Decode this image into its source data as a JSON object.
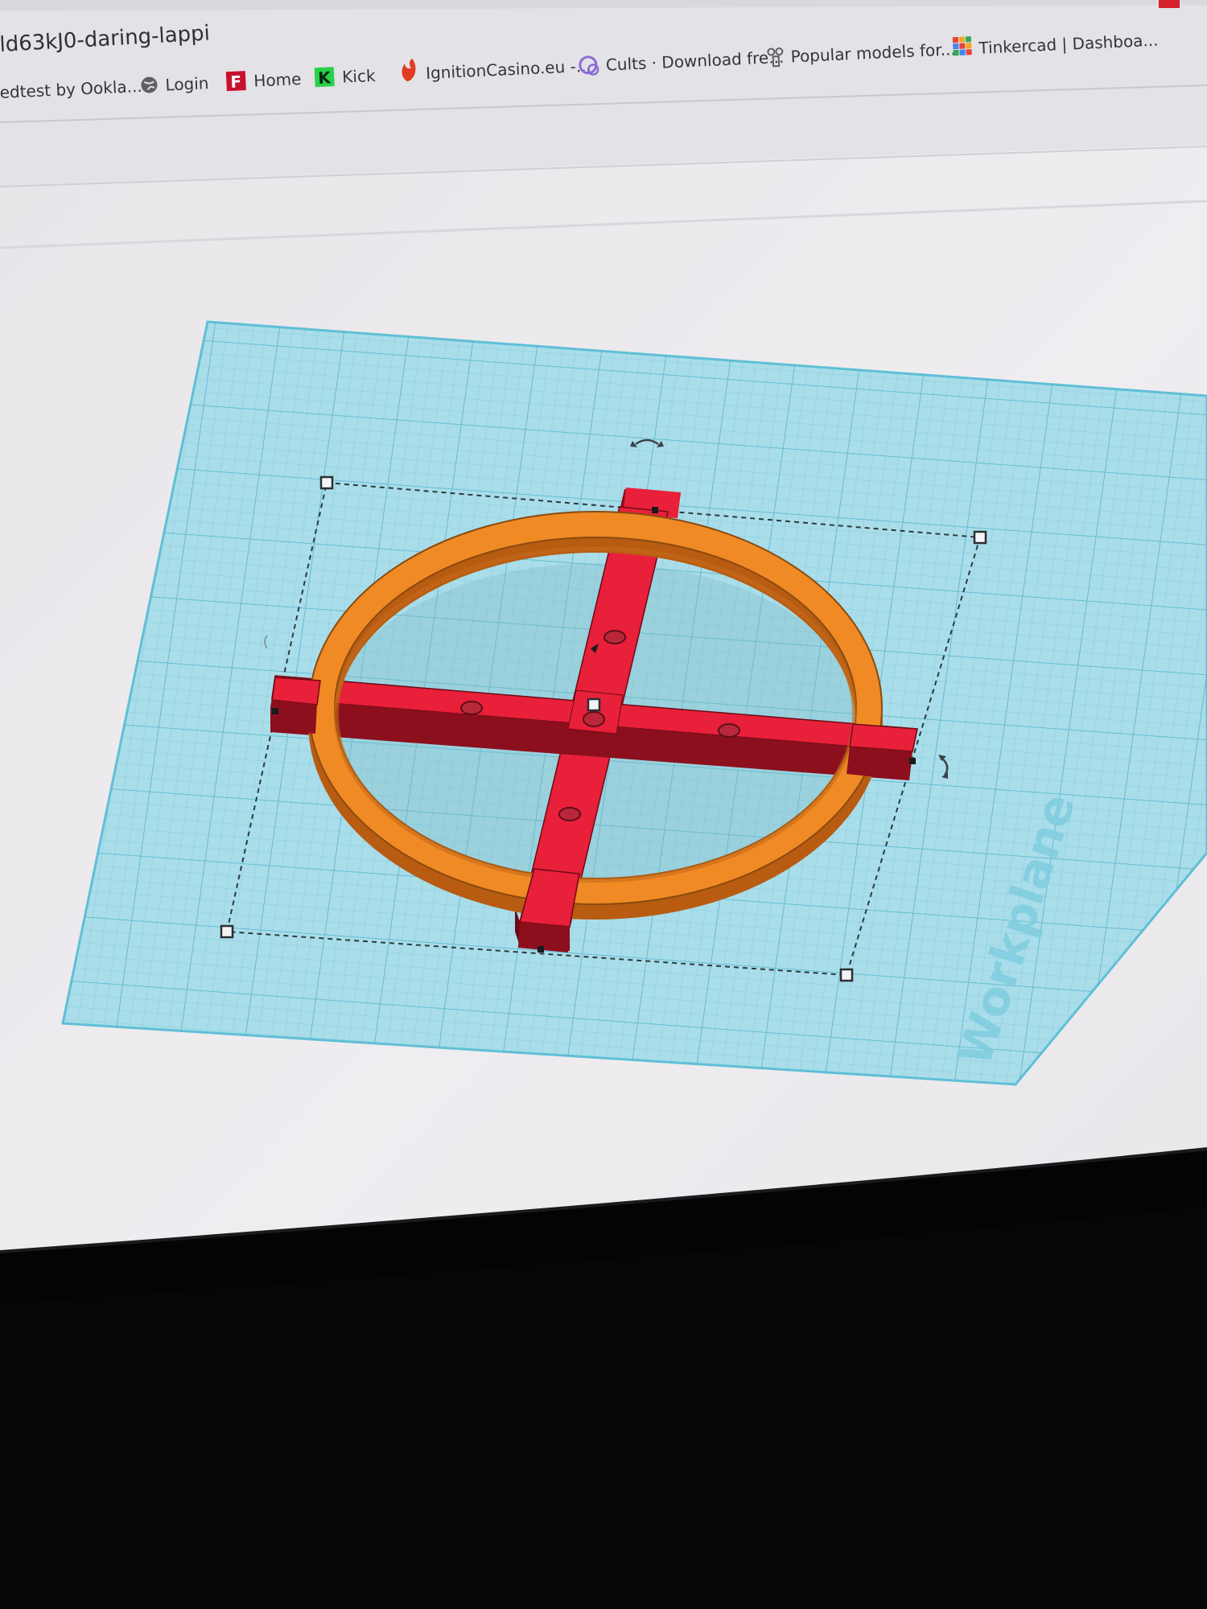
{
  "browser": {
    "tab_title": "ld63kJ0-daring-lappi",
    "bookmarks": [
      {
        "label": "edtest by Ookla...",
        "icon": "speedtest-icon"
      },
      {
        "label": "Login",
        "icon": "globe-icon"
      },
      {
        "label": "Home",
        "icon": "f-logo-icon"
      },
      {
        "label": "Kick",
        "icon": "kick-logo-icon"
      },
      {
        "label": "IgnitionCasino.eu -...",
        "icon": "flame-icon"
      },
      {
        "label": "Cults · Download fre...",
        "icon": "cults-logo-icon"
      },
      {
        "label": "Popular models for...",
        "icon": "models-icon"
      },
      {
        "label": "Tinkercad | Dashboa...",
        "icon": "tinkercad-icon"
      }
    ]
  },
  "editor": {
    "workplane_label": "Workplane",
    "colors": {
      "workplane": "#a9dde9",
      "grid": "#6ec4d9",
      "ring": "#f08a24",
      "ring_side": "#b85c12",
      "bar": "#e8203a",
      "bar_side": "#8c0f1e"
    }
  }
}
